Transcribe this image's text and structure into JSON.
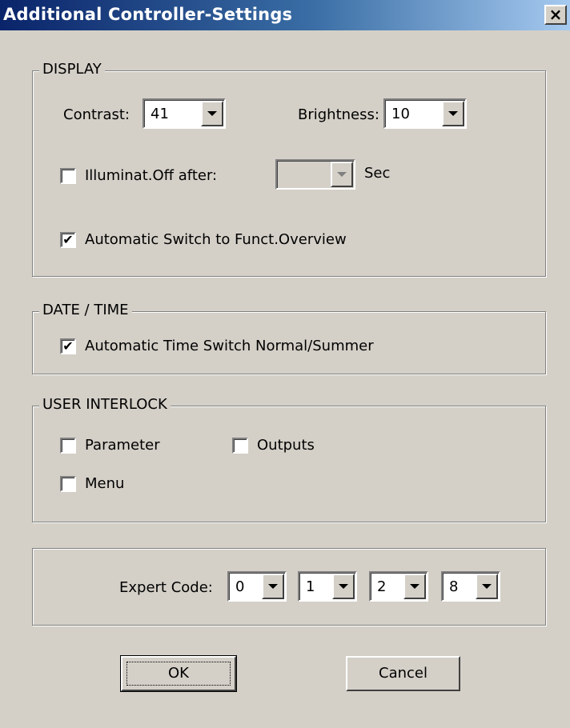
{
  "window": {
    "title": "Additional Controller-Settings",
    "close_glyph": "×"
  },
  "display": {
    "group_label": "DISPLAY",
    "contrast_label": "Contrast:",
    "contrast_value": "41",
    "brightness_label": "Brightness:",
    "brightness_value": "10",
    "illum_label": "Illuminat.Off after:",
    "illum_checked": false,
    "illum_value": "",
    "sec_label": "Sec",
    "auto_switch_label": "Automatic Switch to Funct.Overview",
    "auto_switch_checked": true
  },
  "datetime": {
    "group_label": "DATE / TIME",
    "auto_time_label": "Automatic Time Switch Normal/Summer",
    "auto_time_checked": true
  },
  "interlock": {
    "group_label": "USER INTERLOCK",
    "parameter_label": "Parameter",
    "parameter_checked": false,
    "outputs_label": "Outputs",
    "outputs_checked": false,
    "menu_label": "Menu",
    "menu_checked": false
  },
  "expert": {
    "label": "Expert Code:",
    "codes": [
      "0",
      "1",
      "2",
      "8"
    ]
  },
  "buttons": {
    "ok_label": "OK",
    "cancel_label": "Cancel"
  },
  "check_glyph": "✔",
  "colors": {
    "window_bg": "#d4d0c8",
    "title_start": "#0a246a",
    "title_end": "#a6caf0",
    "title_text": "#ffffff"
  }
}
